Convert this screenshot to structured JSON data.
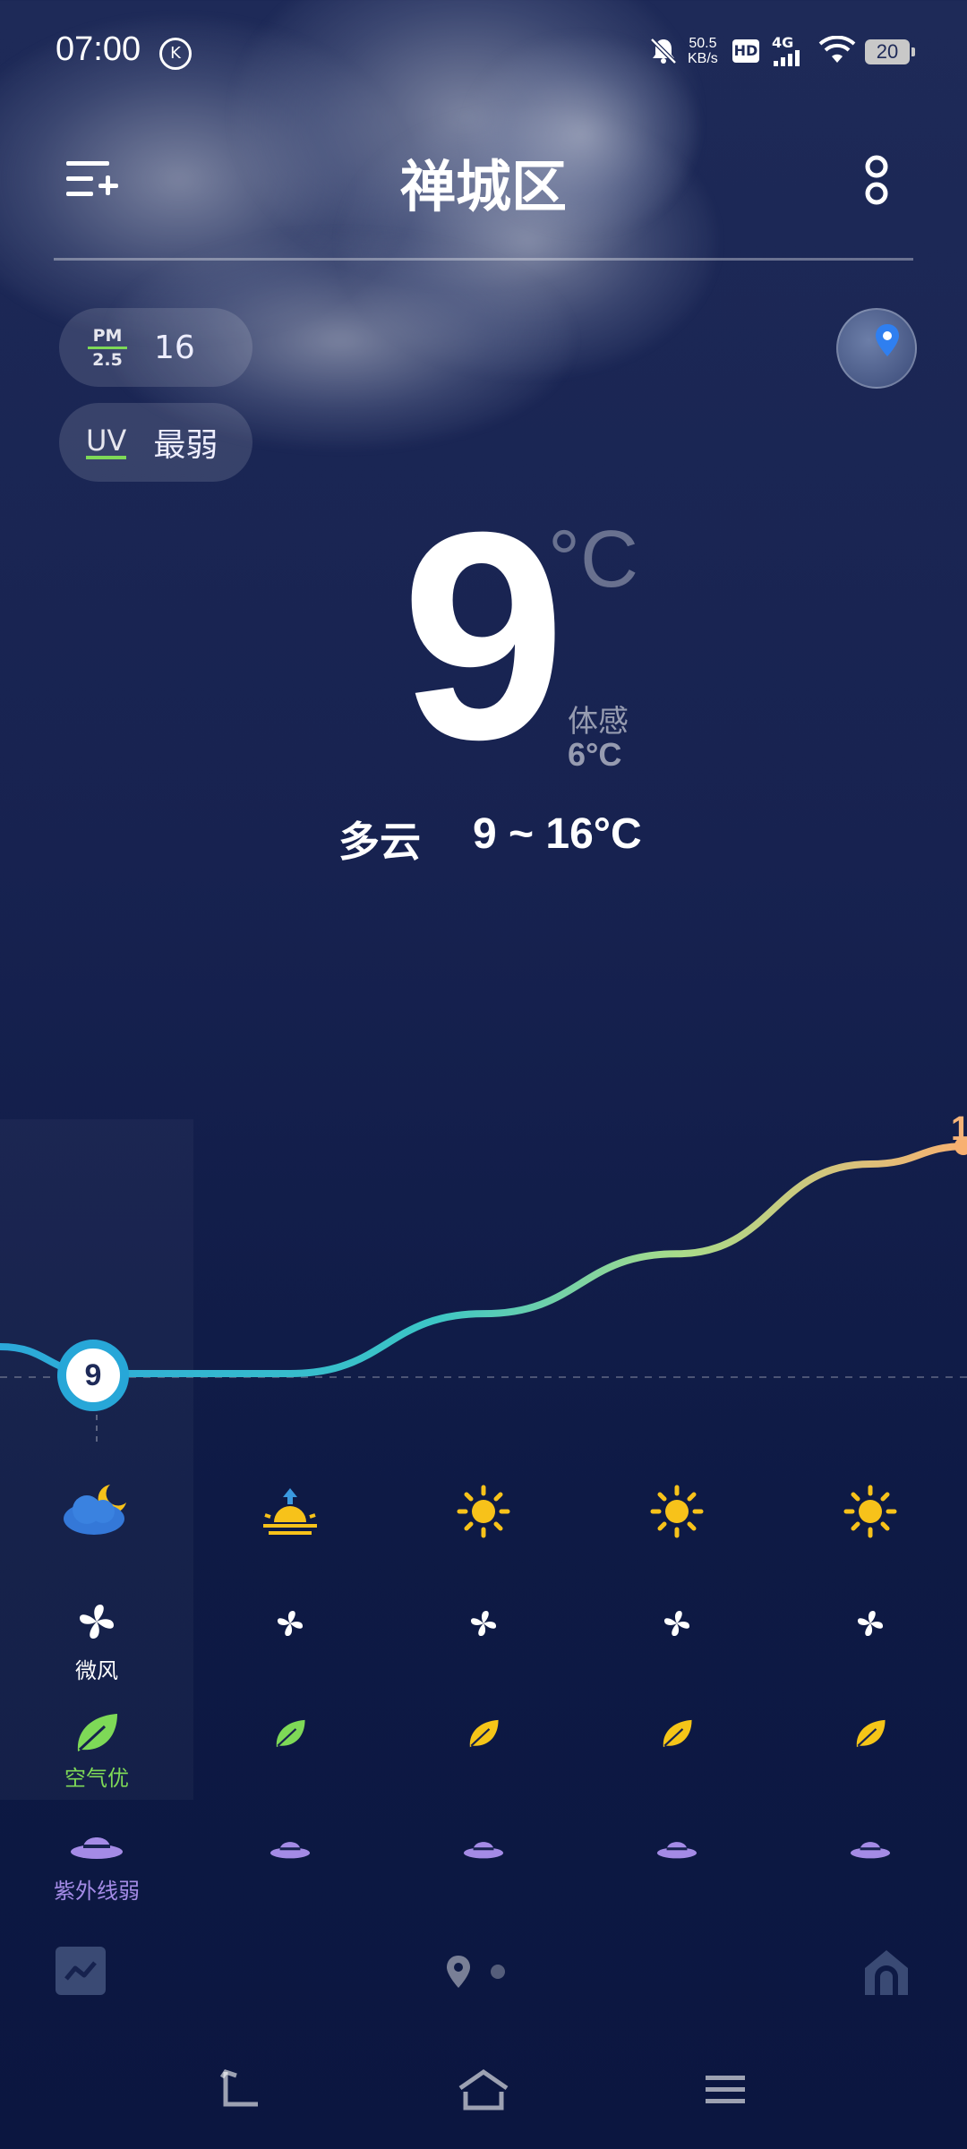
{
  "status_bar": {
    "time": "07:00",
    "k_badge": "K",
    "net_speed_value": "50.5",
    "net_speed_unit": "KB/s",
    "hd": "HD",
    "network": "4G",
    "battery": "20"
  },
  "header": {
    "city": "禅城区"
  },
  "badges": {
    "pm_top": "PM",
    "pm_bottom": "2.5",
    "pm_value": "16",
    "uv_label": "UV",
    "uv_value": "最弱"
  },
  "current": {
    "temperature": "9",
    "unit": "°C",
    "feels_like_label": "体感",
    "feels_like_value": "6°C",
    "condition": "多云",
    "range": "9 ~ 16°C"
  },
  "chart_data": {
    "type": "line",
    "temps": [
      9,
      9,
      11,
      13,
      16
    ],
    "now_label": "9",
    "edge_label": "1"
  },
  "hourly": {
    "weather_icons": [
      "cloud-moon-icon",
      "sunrise-icon",
      "sun-icon",
      "sun-icon",
      "sun-icon"
    ],
    "wind_label": "微风",
    "air_label": "空气优",
    "uv_label": "紫外线弱",
    "leaf_colors": [
      "#7ed957",
      "#7ed957",
      "#f5c518",
      "#f5c518",
      "#f5c518"
    ]
  },
  "colors": {
    "accent_blue": "#27a7d8",
    "leaf_green": "#7ed957",
    "leaf_yellow": "#f5c518",
    "sun_yellow": "#f7c21a",
    "hat_purple": "#a48be6"
  }
}
